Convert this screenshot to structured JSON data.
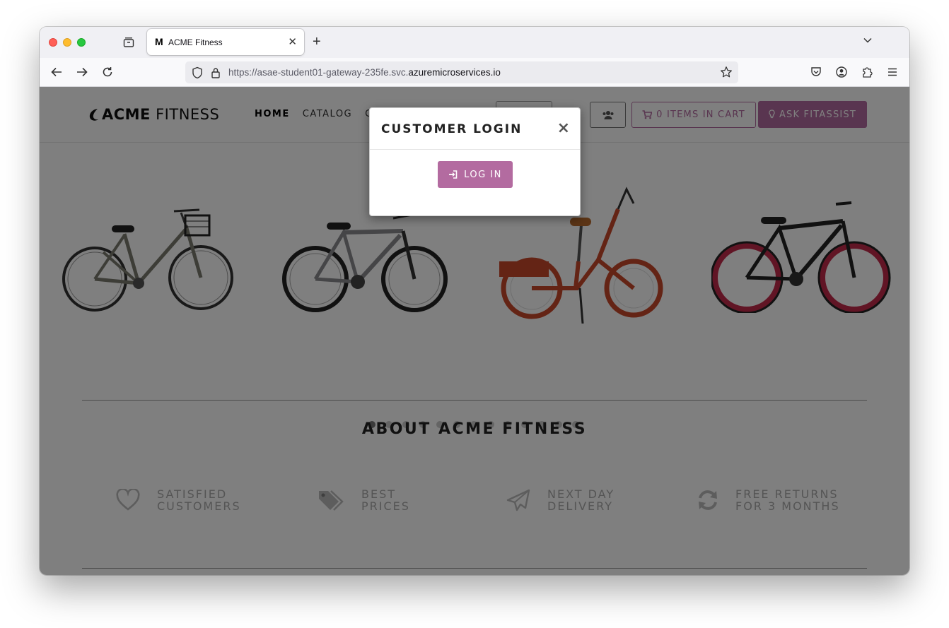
{
  "browser": {
    "tab_title": "ACME Fitness",
    "tab_favicon": "M",
    "url_prefix": "https://asae-student01-gateway-235fe.svc.",
    "url_host": "azuremicroservices.io"
  },
  "site": {
    "logo_bold": "ACME",
    "logo_light": " FITNESS",
    "menu": [
      "HOME",
      "CATALOG",
      "C"
    ],
    "cart_label": "0 ITEMS IN CART",
    "fitassist_label": "ASK FITASSIST",
    "about_title": "ABOUT ACME FITNESS",
    "features": [
      {
        "icon": "heart-icon",
        "text": "SATISFIED\nCUSTOMERS"
      },
      {
        "icon": "tags-icon",
        "text": "BEST\nPRICES"
      },
      {
        "icon": "paper-plane-icon",
        "text": "NEXT DAY\nDELIVERY"
      },
      {
        "icon": "refresh-icon",
        "text": "FREE RETURNS\nFOR 3 MONTHS"
      }
    ],
    "carousel_slide_count": 13,
    "carousel_active_index": 0
  },
  "modal": {
    "title": "CUSTOMER LOGIN",
    "close": "×",
    "login_label": "LOG IN"
  },
  "colors": {
    "brand": "#b36ba0",
    "overlay": "rgba(0,0,0,0.5)"
  }
}
